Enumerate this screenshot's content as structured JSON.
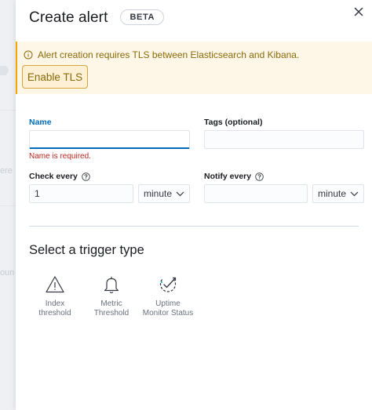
{
  "flyout": {
    "title": "Create alert",
    "badge": "BETA"
  },
  "callout": {
    "text": "Alert creation requires TLS between Elasticsearch and Kibana.",
    "button_label": "Enable TLS"
  },
  "form": {
    "name": {
      "label": "Name",
      "value": "",
      "error": "Name is required."
    },
    "tags": {
      "label": "Tags (optional)",
      "value": ""
    },
    "check_every": {
      "label": "Check every",
      "value": "1",
      "unit": "minute"
    },
    "notify_every": {
      "label": "Notify every",
      "value": "",
      "unit": "minute"
    }
  },
  "triggers": {
    "title": "Select a trigger type",
    "items": [
      {
        "line1": "Index",
        "line2": "threshold",
        "icon": "warning-triangle-icon"
      },
      {
        "line1": "Metric",
        "line2": "Threshold",
        "icon": "bell-icon"
      },
      {
        "line1": "Uptime",
        "line2": "Monitor Status",
        "icon": "uptime-check-icon"
      }
    ]
  },
  "background": {
    "fragment_1": "ere",
    "fragment_2": "oun"
  },
  "colors": {
    "primary": "#006bb8",
    "warning": "#f5a700",
    "danger": "#bd271e"
  }
}
